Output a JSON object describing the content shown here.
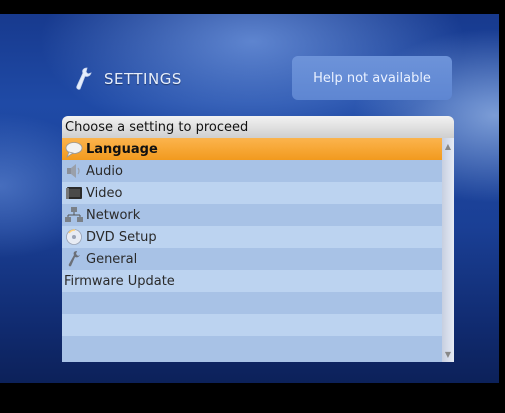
{
  "header": {
    "title": "SETTINGS",
    "icon": "wrench-icon"
  },
  "help": {
    "text": "Help not available"
  },
  "panel": {
    "heading": "Choose a setting to proceed",
    "items": [
      {
        "label": "Language",
        "icon": "language-icon",
        "selected": true
      },
      {
        "label": "Audio",
        "icon": "speaker-icon",
        "selected": false
      },
      {
        "label": "Video",
        "icon": "video-icon",
        "selected": false
      },
      {
        "label": "Network",
        "icon": "network-icon",
        "selected": false
      },
      {
        "label": "DVD Setup",
        "icon": "disc-icon",
        "selected": false
      },
      {
        "label": "General",
        "icon": "wrench-icon",
        "selected": false
      },
      {
        "label": "Firmware Update",
        "icon": "",
        "selected": false
      },
      {
        "label": "",
        "icon": "",
        "selected": false
      },
      {
        "label": "",
        "icon": "",
        "selected": false
      },
      {
        "label": "",
        "icon": "",
        "selected": false
      }
    ]
  },
  "colors": {
    "background": "#1f4aa6",
    "selection": "#f29a1e",
    "help_box": "#6d93d9",
    "list_row": "#bcd3f0",
    "list_row_alt": "#a8c2e6"
  }
}
